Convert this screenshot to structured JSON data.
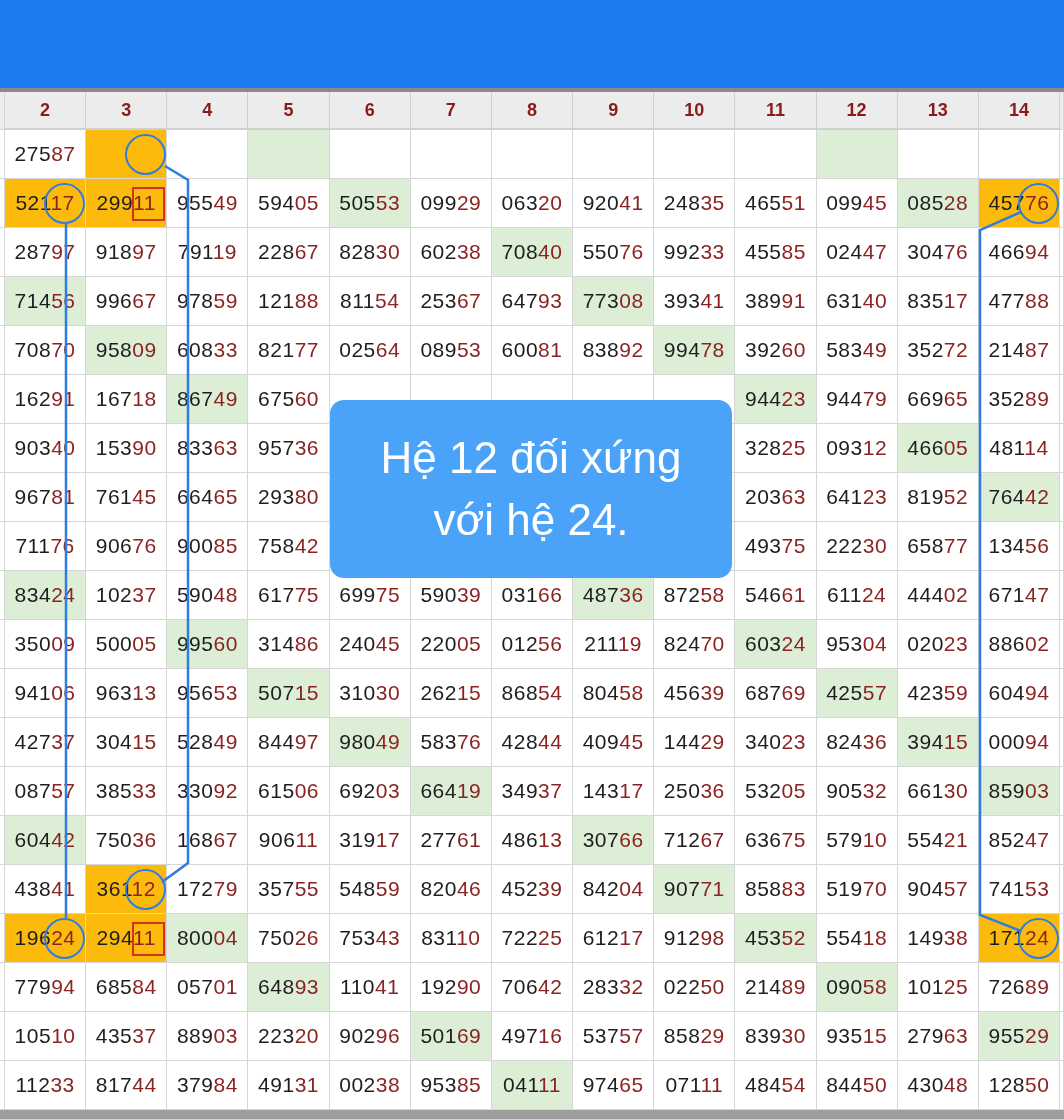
{
  "columns": [
    "2",
    "3",
    "4",
    "5",
    "6",
    "7",
    "8",
    "9",
    "10",
    "11",
    "12",
    "13",
    "14"
  ],
  "rows": [
    {
      "cells": [
        {
          "text": "27587"
        },
        {
          "color": "#fcbb0c",
          "circled": true
        },
        {},
        {
          "color": "#dcefd6"
        },
        {},
        {},
        {},
        {},
        {},
        {},
        {
          "color": "#dcefd6"
        },
        {},
        {}
      ]
    },
    {
      "cells": [
        {
          "text": "52117",
          "color": "#fcbb0c",
          "circled": true
        },
        {
          "text": "29911",
          "color": "#fcbb0c",
          "boxed": true
        },
        {
          "text": "95549"
        },
        {
          "text": "59405"
        },
        {
          "text": "50553",
          "color": "#dcefd6"
        },
        {
          "text": "09929"
        },
        {
          "text": "06320"
        },
        {
          "text": "92041"
        },
        {
          "text": "24835"
        },
        {
          "text": "46551"
        },
        {
          "text": "09945"
        },
        {
          "text": "08528",
          "color": "#dcefd6"
        },
        {
          "text": "45776",
          "color": "#fcbb0c",
          "circled": true
        }
      ]
    },
    {
      "cells": [
        {
          "text": "28797"
        },
        {
          "text": "91897"
        },
        {
          "text": "79119"
        },
        {
          "text": "22867"
        },
        {
          "text": "82830"
        },
        {
          "text": "60238"
        },
        {
          "text": "70840",
          "color": "#dcefd6"
        },
        {
          "text": "55076"
        },
        {
          "text": "99233"
        },
        {
          "text": "45585"
        },
        {
          "text": "02447"
        },
        {
          "text": "30476"
        },
        {
          "text": "46694"
        }
      ]
    },
    {
      "cells": [
        {
          "text": "71456",
          "color": "#dcefd6"
        },
        {
          "text": "99667"
        },
        {
          "text": "97859"
        },
        {
          "text": "12188"
        },
        {
          "text": "81154"
        },
        {
          "text": "25367"
        },
        {
          "text": "64793"
        },
        {
          "text": "77308",
          "color": "#dcefd6"
        },
        {
          "text": "39341"
        },
        {
          "text": "38991"
        },
        {
          "text": "63140"
        },
        {
          "text": "83517"
        },
        {
          "text": "47788"
        }
      ]
    },
    {
      "cells": [
        {
          "text": "70870"
        },
        {
          "text": "95809",
          "color": "#dcefd6"
        },
        {
          "text": "60833"
        },
        {
          "text": "82177"
        },
        {
          "text": "02564"
        },
        {
          "text": "08953"
        },
        {
          "text": "60081"
        },
        {
          "text": "83892"
        },
        {
          "text": "99478",
          "color": "#dcefd6"
        },
        {
          "text": "39260"
        },
        {
          "text": "58349"
        },
        {
          "text": "35272"
        },
        {
          "text": "21487"
        }
      ]
    },
    {
      "cells": [
        {
          "text": "16291"
        },
        {
          "text": "16718"
        },
        {
          "text": "86749",
          "color": "#dcefd6"
        },
        {
          "text": "67560"
        },
        {},
        {},
        {},
        {},
        {},
        {
          "text": "94423",
          "color": "#dcefd6"
        },
        {
          "text": "94479"
        },
        {
          "text": "66965"
        },
        {
          "text": "35289"
        }
      ]
    },
    {
      "cells": [
        {
          "text": "90340"
        },
        {
          "text": "15390"
        },
        {
          "text": "83363"
        },
        {
          "text": "95736"
        },
        {},
        {},
        {},
        {},
        {},
        {
          "text": "32825"
        },
        {
          "text": "09312"
        },
        {
          "text": "46605",
          "color": "#dcefd6"
        },
        {
          "text": "48114"
        }
      ]
    },
    {
      "cells": [
        {
          "text": "96781"
        },
        {
          "text": "76145"
        },
        {
          "text": "66465"
        },
        {
          "text": "29380"
        },
        {},
        {},
        {},
        {},
        {},
        {
          "text": "20363"
        },
        {
          "text": "64123"
        },
        {
          "text": "81952"
        },
        {
          "text": "76442",
          "color": "#dcefd6"
        }
      ]
    },
    {
      "cells": [
        {
          "text": "71176"
        },
        {
          "text": "90676"
        },
        {
          "text": "90085"
        },
        {
          "text": "75842"
        },
        {},
        {},
        {},
        {},
        {},
        {
          "text": "49375"
        },
        {
          "text": "22230"
        },
        {
          "text": "65877"
        },
        {
          "text": "13456"
        }
      ]
    },
    {
      "cells": [
        {
          "text": "83424",
          "color": "#dcefd6"
        },
        {
          "text": "10237"
        },
        {
          "text": "59048"
        },
        {
          "text": "61775"
        },
        {
          "text": "69975"
        },
        {
          "text": "59039"
        },
        {
          "text": "03166"
        },
        {
          "text": "48736",
          "color": "#dcefd6"
        },
        {
          "text": "87258"
        },
        {
          "text": "54661"
        },
        {
          "text": "61124"
        },
        {
          "text": "44402"
        },
        {
          "text": "67147"
        }
      ]
    },
    {
      "cells": [
        {
          "text": "35009"
        },
        {
          "text": "50005"
        },
        {
          "text": "99560",
          "color": "#dcefd6"
        },
        {
          "text": "31486"
        },
        {
          "text": "24045"
        },
        {
          "text": "22005"
        },
        {
          "text": "01256"
        },
        {
          "text": "21119"
        },
        {
          "text": "82470"
        },
        {
          "text": "60324",
          "color": "#dcefd6"
        },
        {
          "text": "95304"
        },
        {
          "text": "02023"
        },
        {
          "text": "88602"
        }
      ]
    },
    {
      "cells": [
        {
          "text": "94106"
        },
        {
          "text": "96313"
        },
        {
          "text": "95653"
        },
        {
          "text": "50715",
          "color": "#dcefd6"
        },
        {
          "text": "31030"
        },
        {
          "text": "26215"
        },
        {
          "text": "86854"
        },
        {
          "text": "80458"
        },
        {
          "text": "45639"
        },
        {
          "text": "68769"
        },
        {
          "text": "42557",
          "color": "#dcefd6"
        },
        {
          "text": "42359"
        },
        {
          "text": "60494"
        }
      ]
    },
    {
      "cells": [
        {
          "text": "42737"
        },
        {
          "text": "30415"
        },
        {
          "text": "52849"
        },
        {
          "text": "84497"
        },
        {
          "text": "98049",
          "color": "#dcefd6"
        },
        {
          "text": "58376"
        },
        {
          "text": "42844"
        },
        {
          "text": "40945"
        },
        {
          "text": "14429"
        },
        {
          "text": "34023"
        },
        {
          "text": "82436"
        },
        {
          "text": "39415",
          "color": "#dcefd6"
        },
        {
          "text": "00094"
        }
      ]
    },
    {
      "cells": [
        {
          "text": "08757"
        },
        {
          "text": "38533"
        },
        {
          "text": "33092"
        },
        {
          "text": "61506"
        },
        {
          "text": "69203"
        },
        {
          "text": "66419",
          "color": "#dcefd6"
        },
        {
          "text": "34937"
        },
        {
          "text": "14317"
        },
        {
          "text": "25036"
        },
        {
          "text": "53205"
        },
        {
          "text": "90532"
        },
        {
          "text": "66130"
        },
        {
          "text": "85903",
          "color": "#dcefd6"
        }
      ]
    },
    {
      "cells": [
        {
          "text": "60442",
          "color": "#dcefd6"
        },
        {
          "text": "75036"
        },
        {
          "text": "16867"
        },
        {
          "text": "90611"
        },
        {
          "text": "31917"
        },
        {
          "text": "27761"
        },
        {
          "text": "48613"
        },
        {
          "text": "30766",
          "color": "#dcefd6"
        },
        {
          "text": "71267"
        },
        {
          "text": "63675"
        },
        {
          "text": "57910"
        },
        {
          "text": "55421"
        },
        {
          "text": "85247"
        }
      ]
    },
    {
      "cells": [
        {
          "text": "43841"
        },
        {
          "text": "36112",
          "color": "#fcbb0c",
          "circled": true
        },
        {
          "text": "17279"
        },
        {
          "text": "35755"
        },
        {
          "text": "54859"
        },
        {
          "text": "82046"
        },
        {
          "text": "45239"
        },
        {
          "text": "84204"
        },
        {
          "text": "90771",
          "color": "#dcefd6"
        },
        {
          "text": "85883"
        },
        {
          "text": "51970"
        },
        {
          "text": "90457"
        },
        {
          "text": "74153"
        }
      ]
    },
    {
      "cells": [
        {
          "text": "19624",
          "color": "#fcbb0c",
          "circled": true
        },
        {
          "text": "29411",
          "color": "#fcbb0c",
          "boxed": true
        },
        {
          "text": "80004",
          "color": "#dcefd6"
        },
        {
          "text": "75026"
        },
        {
          "text": "75343"
        },
        {
          "text": "83110"
        },
        {
          "text": "72225"
        },
        {
          "text": "61217"
        },
        {
          "text": "91298"
        },
        {
          "text": "45352",
          "color": "#dcefd6"
        },
        {
          "text": "55418"
        },
        {
          "text": "14938"
        },
        {
          "text": "17124",
          "color": "#fcbb0c",
          "circled": true
        }
      ]
    },
    {
      "cells": [
        {
          "text": "77994"
        },
        {
          "text": "68584"
        },
        {
          "text": "05701"
        },
        {
          "text": "64893",
          "color": "#dcefd6"
        },
        {
          "text": "11041"
        },
        {
          "text": "19290"
        },
        {
          "text": "70642"
        },
        {
          "text": "28332"
        },
        {
          "text": "02250"
        },
        {
          "text": "21489"
        },
        {
          "text": "09058",
          "color": "#dcefd6"
        },
        {
          "text": "10125"
        },
        {
          "text": "72689"
        }
      ]
    },
    {
      "cells": [
        {
          "text": "10510"
        },
        {
          "text": "43537"
        },
        {
          "text": "88903"
        },
        {
          "text": "22320"
        },
        {
          "text": "90296"
        },
        {
          "text": "50169",
          "color": "#dcefd6"
        },
        {
          "text": "49716"
        },
        {
          "text": "53757"
        },
        {
          "text": "85829"
        },
        {
          "text": "83930"
        },
        {
          "text": "93515"
        },
        {
          "text": "27963"
        },
        {
          "text": "95529",
          "color": "#dcefd6"
        }
      ]
    },
    {
      "cells": [
        {
          "text": "11233"
        },
        {
          "text": "81744"
        },
        {
          "text": "37984"
        },
        {
          "text": "49131"
        },
        {
          "text": "00238"
        },
        {
          "text": "95385"
        },
        {
          "text": "04111",
          "color": "#dcefd6"
        },
        {
          "text": "97465"
        },
        {
          "text": "07111"
        },
        {
          "text": "48454"
        },
        {
          "text": "84450"
        },
        {
          "text": "43048"
        },
        {
          "text": "12850"
        }
      ]
    }
  ],
  "callout": {
    "lines": [
      "Hệ 12 đối xứng",
      "với hệ 24."
    ]
  }
}
